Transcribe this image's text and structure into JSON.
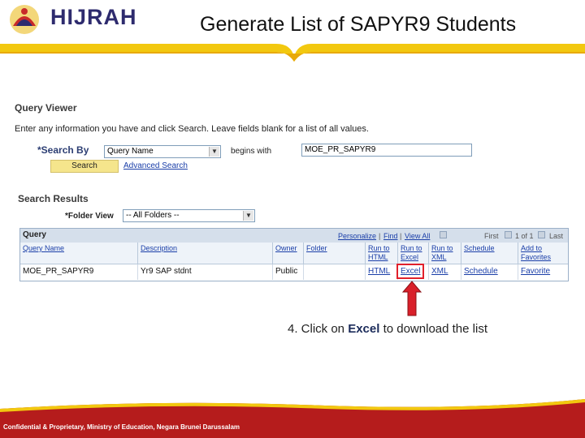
{
  "slide_title": "Generate List of SAPYR9 Students",
  "logo": {
    "text": "HIJRAH",
    "subtitle": ""
  },
  "query_viewer": {
    "title": "Query Viewer",
    "instruction": "Enter any information you have and click Search. Leave fields blank for a list of all values.",
    "search_by_label": "*Search By",
    "search_by_value": "Query Name",
    "operator_label": "begins with",
    "search_value": "MOE_PR_SAPYR9",
    "search_button": "Search",
    "advanced_search_link": "Advanced Search"
  },
  "search_results": {
    "title": "Search Results",
    "folder_view_label": "*Folder View",
    "folder_view_value": "-- All Folders --",
    "grid": {
      "title": "Query",
      "nav": {
        "personalize": "Personalize",
        "find": "Find",
        "view_all": "View All",
        "first": "First",
        "range": "1 of 1",
        "last": "Last"
      },
      "columns": [
        "Query Name",
        "Description",
        "Owner",
        "Folder",
        "Run to HTML",
        "Run to Excel",
        "Run to XML",
        "Schedule",
        "Add to Favorites"
      ],
      "rows": [
        [
          "MOE_PR_SAPYR9",
          "Yr9 SAP stdnt",
          "Public",
          "",
          "HTML",
          "Excel",
          "XML",
          "Schedule",
          "Favorite"
        ]
      ]
    }
  },
  "callout": {
    "prefix": "4. Click on ",
    "highlight": "Excel",
    "suffix": " to download the list"
  },
  "footer_text": "Confidential & Proprietary, Ministry of Education, Negara Brunei Darussalam",
  "colors": {
    "accent_gold": "#f2c80f",
    "highlight_red": "#e1202b",
    "link_blue": "#1a3ea8",
    "footer_red": "#b51c1c"
  }
}
